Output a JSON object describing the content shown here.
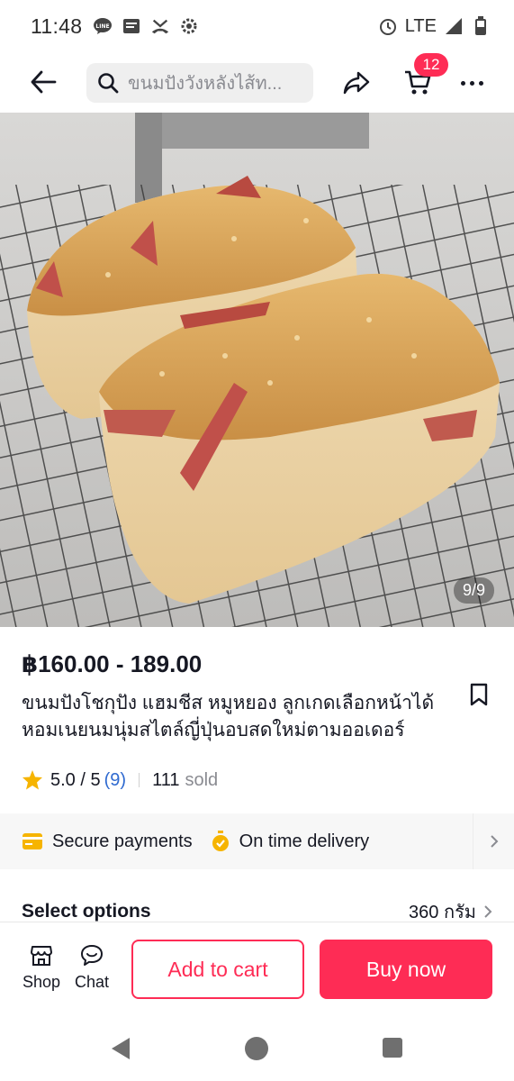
{
  "status_bar": {
    "time": "11:48",
    "network": "LTE",
    "icons": [
      "line-icon",
      "message-icon",
      "missed-call-icon",
      "settings-icon",
      "alarm-icon",
      "signal-icon",
      "battery-icon"
    ]
  },
  "top_nav": {
    "search_placeholder": "ขนมปังวังหลังไส้ท...",
    "cart_count": "12"
  },
  "product_image": {
    "counter": "9/9"
  },
  "product": {
    "price": "฿160.00 - 189.00",
    "title": "ขนมปังโชกุปัง แฮมชีส หมูหยอง ลูกเกดเลือกหน้าได้ หอมเนยนมนุ่มสไตล์ญี่ปุ่นอบสดใหม่ตามออเดอร์",
    "rating": "5.0 / 5",
    "rating_count": "(9)",
    "sold_count": "111",
    "sold_label": "sold"
  },
  "secure_strip": {
    "payments": "Secure payments",
    "delivery": "On time delivery"
  },
  "select_options": {
    "label": "Select options",
    "value": "360 กรัม"
  },
  "bottom_bar": {
    "shop_label": "Shop",
    "chat_label": "Chat",
    "add_to_cart": "Add to cart",
    "buy_now": "Buy now"
  },
  "colors": {
    "accent": "#fe2c55",
    "link": "#2f6ad0",
    "star": "#f6b400"
  }
}
